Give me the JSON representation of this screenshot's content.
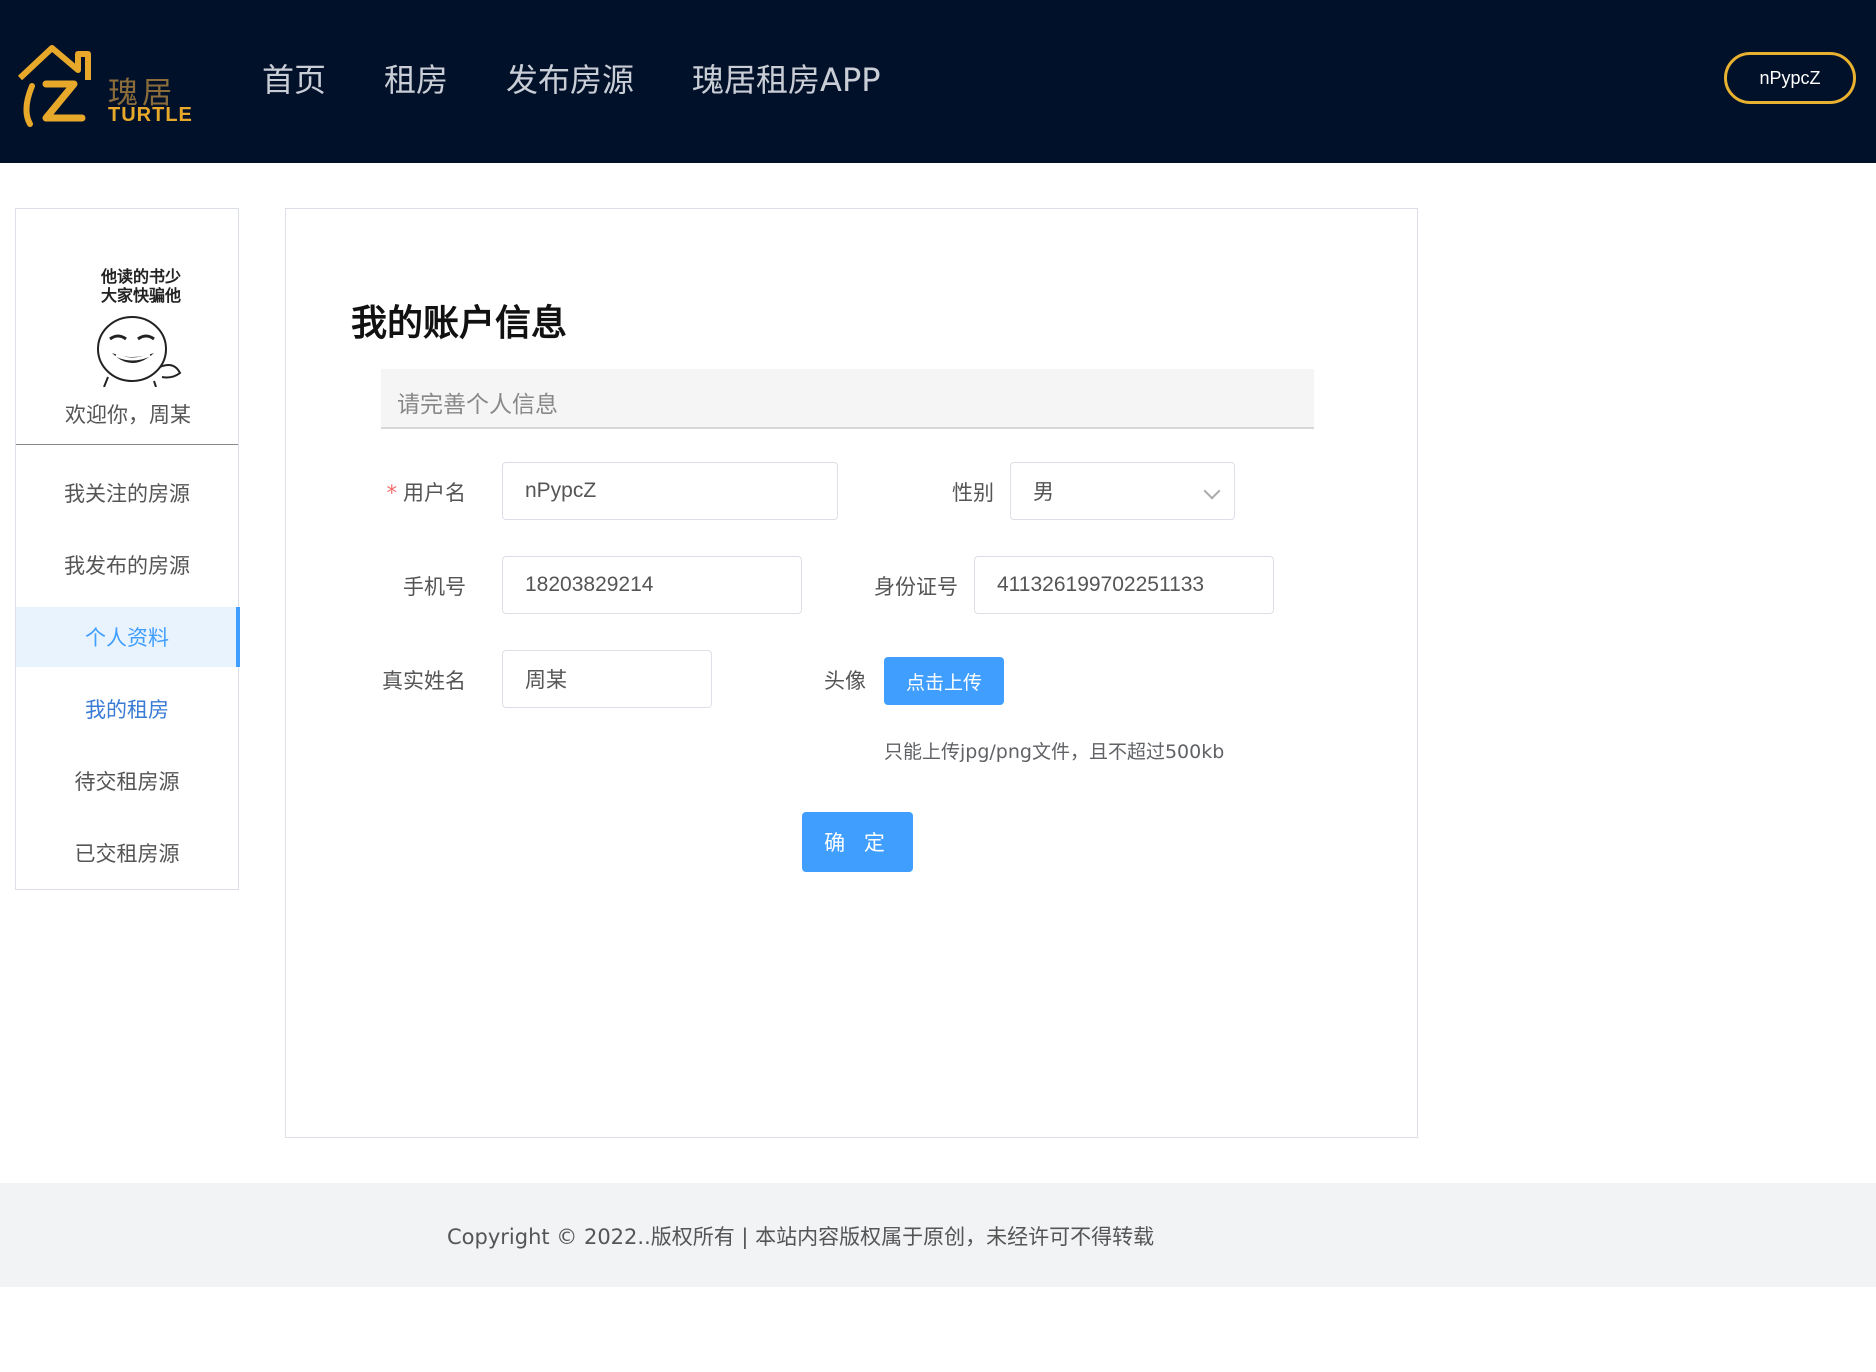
{
  "header": {
    "logo_cn": "瑰居",
    "logo_en": "TURTLE",
    "nav": [
      "首页",
      "租房",
      "发布房源",
      "瑰居租房APP"
    ],
    "user_button": "nPypcZ"
  },
  "sidebar": {
    "avatar_caption_line1": "他读的书少",
    "avatar_caption_line2": "大家快骗他",
    "welcome": "欢迎你，周某",
    "menu": [
      "我关注的房源",
      "我发布的房源",
      "个人资料",
      "我的租房",
      "待交租房源",
      "已交租房源"
    ]
  },
  "form": {
    "title": "我的账户信息",
    "info_bar": "请完善个人信息",
    "required_mark": "*",
    "username_label": "用户名",
    "username_value": "nPypcZ",
    "gender_label": "性别",
    "gender_value": "男",
    "phone_label": "手机号",
    "phone_value": "18203829214",
    "idcard_label": "身份证号",
    "idcard_value": "411326199702251133",
    "realname_label": "真实姓名",
    "realname_value": "周某",
    "avatar_label": "头像",
    "upload_button": "点击上传",
    "upload_tip": "只能上传jpg/png文件，且不超过500kb",
    "confirm_button": "确 定"
  },
  "footer": {
    "copyright": "Copyright © 2022..版权所有 | 本站内容版权属于原创，未经许可不得转载"
  },
  "colors": {
    "header_bg": "#02112a",
    "accent": "#409eff",
    "logo_gold": "#e8a92a"
  }
}
